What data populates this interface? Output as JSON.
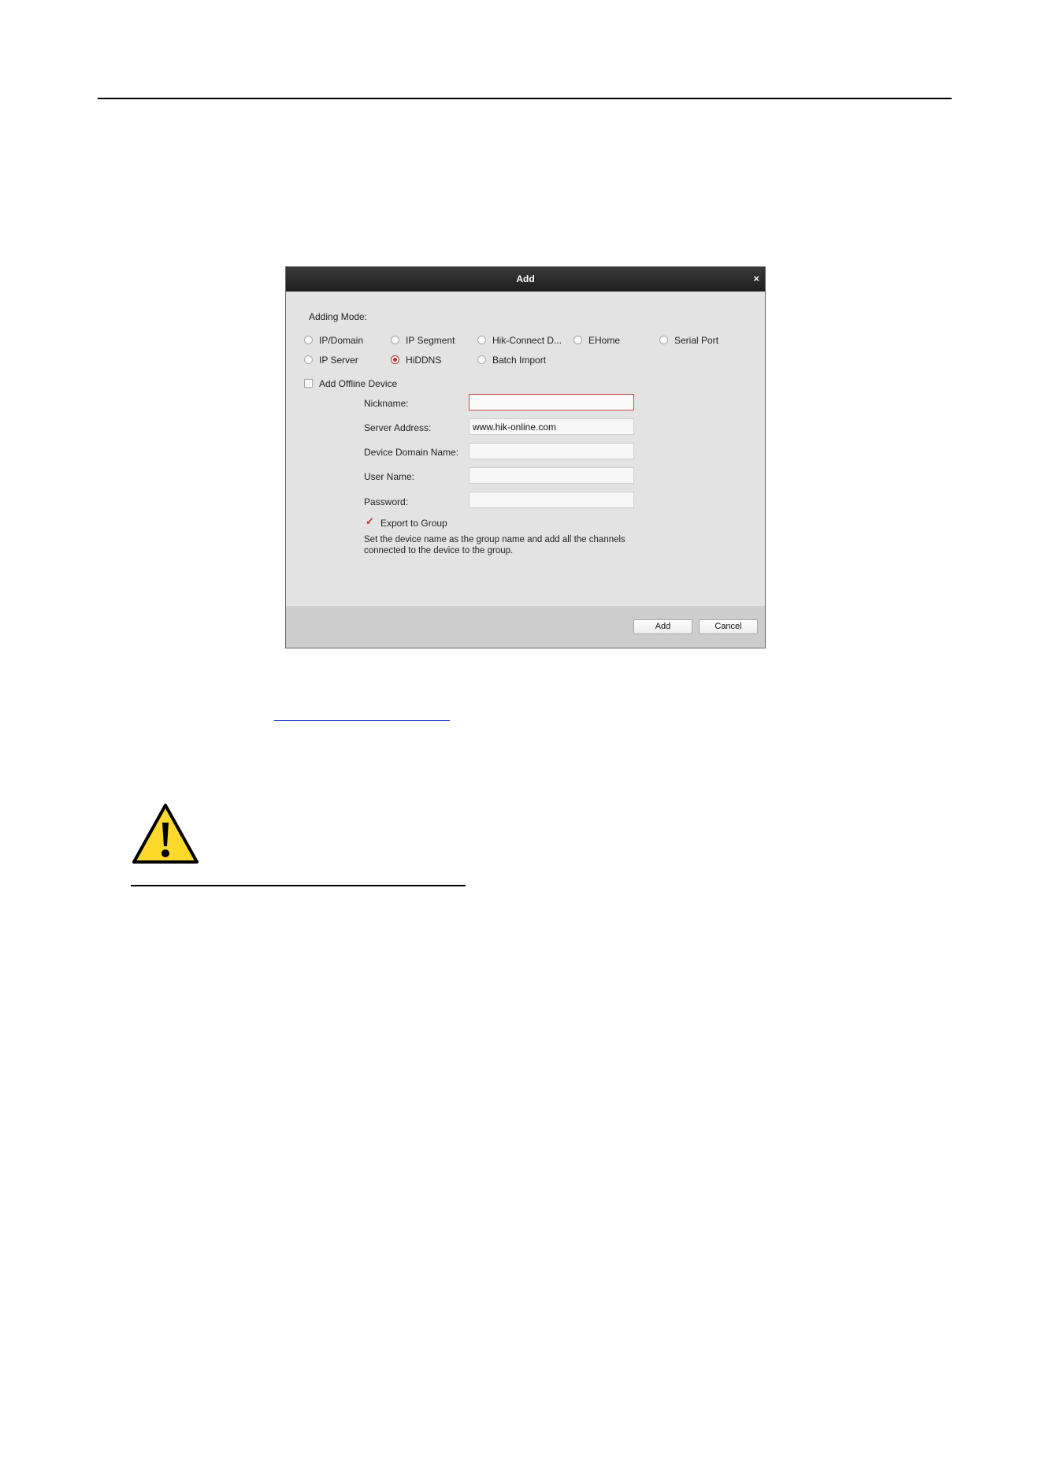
{
  "dialog": {
    "title": "Add",
    "close_glyph": "×",
    "adding_mode_label": "Adding Mode:",
    "modes": [
      {
        "label": "IP/Domain",
        "checked": false
      },
      {
        "label": "IP Segment",
        "checked": false
      },
      {
        "label": "Hik-Connect D...",
        "checked": false
      },
      {
        "label": "EHome",
        "checked": false
      },
      {
        "label": "Serial Port",
        "checked": false
      },
      {
        "label": "IP Server",
        "checked": false
      },
      {
        "label": "HiDDNS",
        "checked": true
      },
      {
        "label": "Batch Import",
        "checked": false
      }
    ],
    "offline_device_label": "Add Offline Device",
    "offline_device_checked": false,
    "fields": {
      "nickname": {
        "label": "Nickname:",
        "value": ""
      },
      "server_address": {
        "label": "Server Address:",
        "value": "www.hik-online.com"
      },
      "device_domain_name": {
        "label": "Device Domain Name:",
        "value": ""
      },
      "user_name": {
        "label": "User Name:",
        "value": ""
      },
      "password": {
        "label": "Password:",
        "value": ""
      }
    },
    "export_to_group_label": "Export to Group",
    "export_to_group_checked": true,
    "export_hint_line1": "Set the device name as the group name and add all the channels",
    "export_hint_line2": "connected to the device to the group.",
    "add_button": "Add",
    "cancel_button": "Cancel",
    "accent_color": "#c82828"
  },
  "page": {
    "warning_icon": "warning-triangle-icon",
    "warning_color": "#fdd92b"
  }
}
